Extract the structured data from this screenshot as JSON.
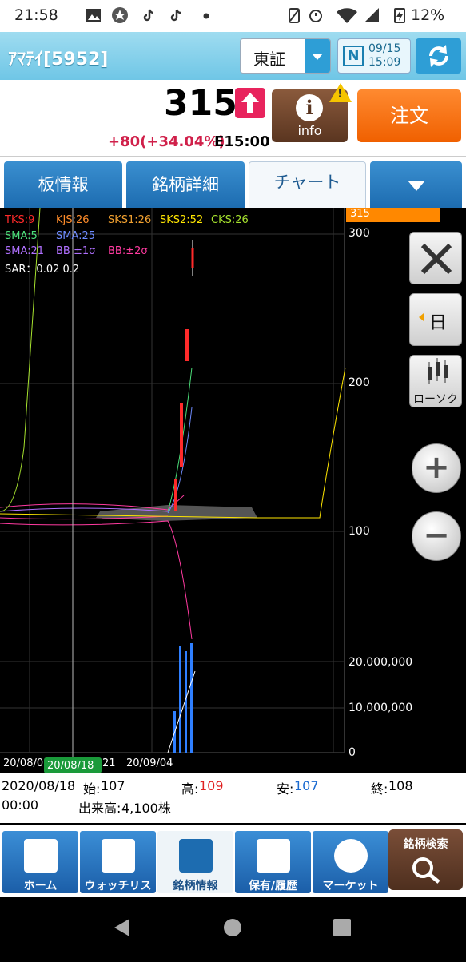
{
  "status": {
    "time": "21:58",
    "battery": "12%",
    "icons": [
      "image-icon",
      "star-icon",
      "tiktok-icon",
      "tiktok-icon",
      "dot-icon",
      "vibrate-icon",
      "alarm-icon",
      "wifi-icon",
      "signal-icon",
      "battery-icon"
    ]
  },
  "header": {
    "stock_name": "ｱﾏﾃｲ[5952]",
    "market": "東証",
    "n_label": "N",
    "date": "09/15",
    "time": "15:09"
  },
  "quote": {
    "price": "315",
    "change": "+80(+34.04%)",
    "price_time": "E15:00",
    "info_label": "info",
    "warning": "!",
    "order_label": "注文"
  },
  "tabs": [
    "板情報",
    "銘柄詳細",
    "チャート"
  ],
  "chart": {
    "legend": {
      "tks": "TKS:9",
      "kjs": "KJS:26",
      "sks1": "SKS1:26",
      "sks2": "SKS2:52",
      "cks": "CKS:26",
      "sma5": "SMA:5",
      "sma25": "SMA:25",
      "sma21": "SMA:21",
      "bb1": "BB ±1σ",
      "bb2": "BB:±2σ",
      "sar": "SAR：0.02 0.2"
    },
    "price_axis": [
      "300",
      "200",
      "100"
    ],
    "volume_axis": [
      "20,000,000",
      "10,000,000",
      "0"
    ],
    "current_price_tag": "315",
    "x_labels": [
      "20/08/0",
      "21",
      "20/09/04"
    ],
    "cursor_date": "20/08/18",
    "side_buttons": {
      "period": "日",
      "candle": "ローソク"
    },
    "colors": {
      "tks": "#ff2a2a",
      "kjs": "#ff8c2a",
      "sks1": "#f0a030",
      "sks2": "#ffe600",
      "cks": "#a6e22e",
      "sma5": "#4ce07a",
      "sma25": "#6f8cff",
      "sma21": "#b070ff",
      "bb": "#ff3aa0",
      "price_tag": "#ff8800"
    }
  },
  "info": {
    "date": "2020/08/18",
    "open_label": "始:",
    "open": "107",
    "high_label": "高:",
    "high": "109",
    "low_label": "安:",
    "low": "107",
    "close_label": "終:",
    "close": "108",
    "time": "00:00",
    "volume_label": "出来高:",
    "volume": "4,100株"
  },
  "nav": [
    "ホーム",
    "ウォッチリスト",
    "銘柄情報",
    "保有/履歴",
    "マーケット",
    "銘柄検索"
  ]
}
